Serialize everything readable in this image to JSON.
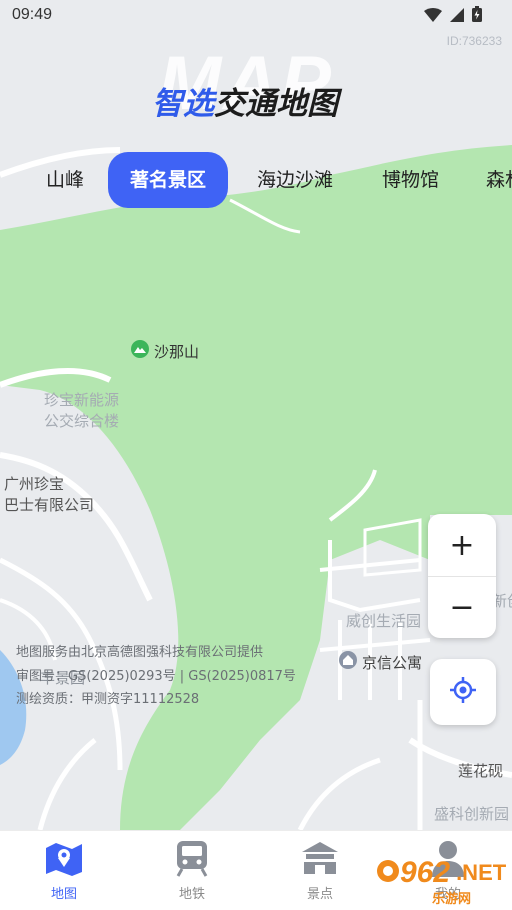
{
  "status": {
    "time": "09:49",
    "device_id": "ID:736233"
  },
  "header": {
    "bg_word": "MAP",
    "title_accent": "智选",
    "title_rest": "交通地图"
  },
  "tabs": [
    {
      "label": "山峰",
      "active": false
    },
    {
      "label": "著名景区",
      "active": true
    },
    {
      "label": "海边沙滩",
      "active": false
    },
    {
      "label": "博物馆",
      "active": false
    },
    {
      "label": "森林",
      "active": false
    }
  ],
  "map": {
    "poi_mountain": "沙那山",
    "label_bus_station": "珍宝新能源公交综合楼",
    "label_bus_station_l1": "珍宝新能源",
    "label_bus_station_l2": "公交综合楼",
    "label_company_l1": "广州珍宝",
    "label_company_l2": "巴士有限公司",
    "label_park": "丰景园",
    "label_community": "威创生活园",
    "poi_apartment": "京信公寓",
    "label_road": "莲花砚",
    "label_shengke": "盛科创新园",
    "label_edge": "新创",
    "attribution": [
      "地图服务由北京高德图强科技有限公司提供",
      "审图号：GS(2025)0293号 | GS(2025)0817号",
      "测绘资质：甲测资字11112528"
    ]
  },
  "controls": {
    "zoom_in": "+",
    "zoom_out": "−"
  },
  "nav": [
    {
      "label": "地图",
      "icon": "map-icon",
      "active": true
    },
    {
      "label": "地铁",
      "icon": "metro-icon",
      "active": false
    },
    {
      "label": "景点",
      "icon": "landmark-icon",
      "active": false
    },
    {
      "label": "我的",
      "icon": "person-icon",
      "active": false
    }
  ],
  "watermark": {
    "num": "962",
    "net": ".NET",
    "cn": "乐游网"
  },
  "colors": {
    "accent": "#3f63f5",
    "park_green": "#b4e6b0",
    "map_bg": "#e9ebee"
  }
}
